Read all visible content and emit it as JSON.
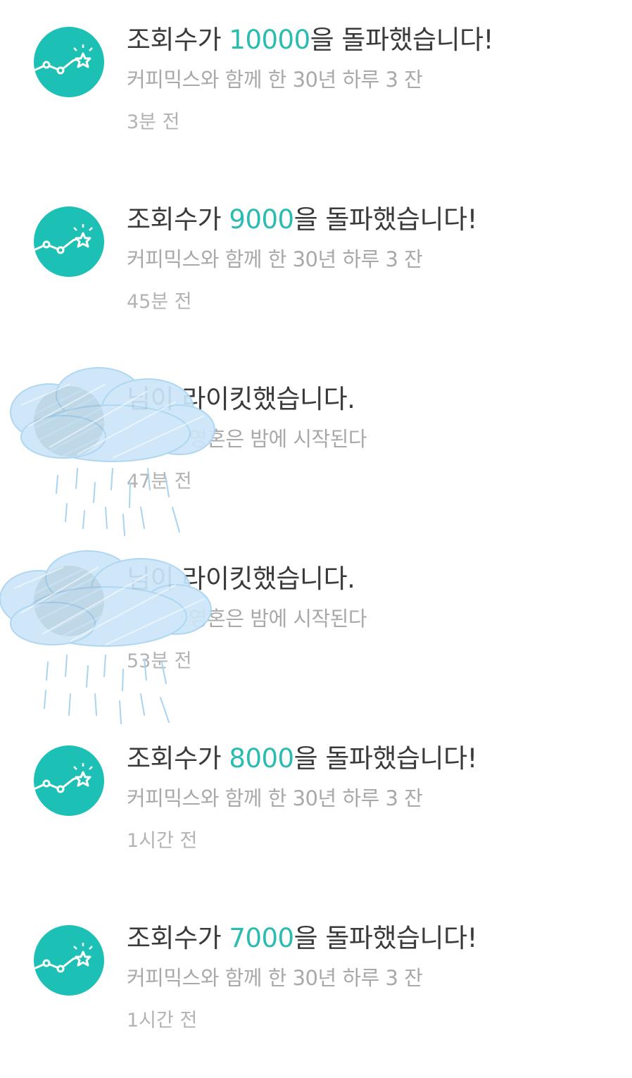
{
  "notifications": [
    {
      "type": "views",
      "icon": "chart-star-icon",
      "title_prefix": "조회수가 ",
      "title_highlight": "10000",
      "title_suffix": "을 돌파했습니다!",
      "subtitle": "커피믹스와 함께 한 30년 하루 3 잔",
      "time": "3분 전"
    },
    {
      "type": "views",
      "icon": "chart-star-icon",
      "title_prefix": "조회수가 ",
      "title_highlight": "9000",
      "title_suffix": "을 돌파했습니다!",
      "subtitle": "커피믹스와 함께 한 30년 하루 3 잔",
      "time": "45분 전"
    },
    {
      "type": "like",
      "icon": "user-avatar",
      "title_highlight": "",
      "title_suffix": "님이 라이킷했습니다.",
      "subtitle": "영혼은 밤에 시작된다",
      "time": "47분 전"
    },
    {
      "type": "like",
      "icon": "user-avatar",
      "title_highlight": "",
      "title_suffix": "님이 라이킷했습니다.",
      "subtitle": "영혼은 밤에 시작된다",
      "time": "53분 전"
    },
    {
      "type": "views",
      "icon": "chart-star-icon",
      "title_prefix": "조회수가 ",
      "title_highlight": "8000",
      "title_suffix": "을 돌파했습니다!",
      "subtitle": "커피믹스와 함께 한 30년 하루 3 잔",
      "time": "1시간 전"
    },
    {
      "type": "views",
      "icon": "chart-star-icon",
      "title_prefix": "조회수가 ",
      "title_highlight": "7000",
      "title_suffix": "을 돌파했습니다!",
      "subtitle": "커피믹스와 함께 한 30년 하루 3 잔",
      "time": "1시간 전"
    }
  ],
  "colors": {
    "accent": "#1cc0b4",
    "highlight_text": "#2bbcb0",
    "title_text": "#3a3a3a",
    "sub_text": "#a9a9a9",
    "redaction_scribble": "#b9dcf3"
  }
}
